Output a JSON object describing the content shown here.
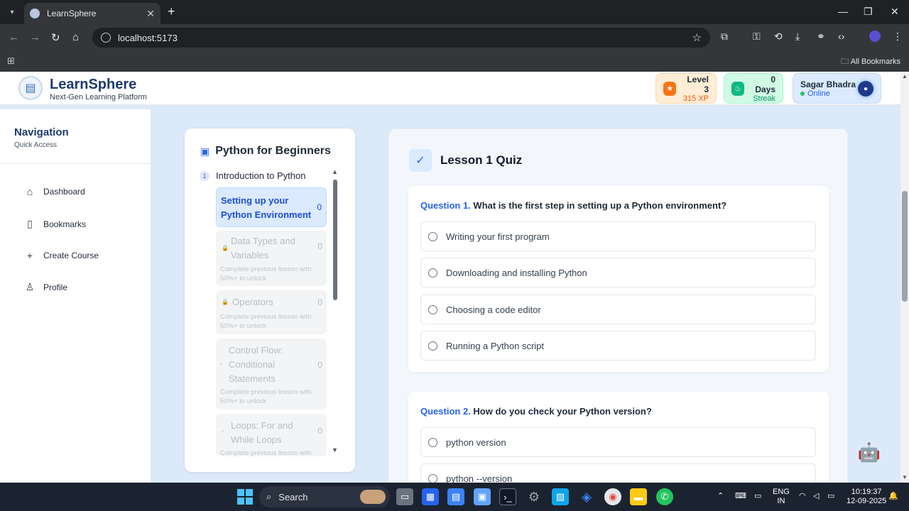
{
  "browser": {
    "tab_title": "LearnSphere",
    "url": "localhost:5173",
    "all_bookmarks": "All Bookmarks"
  },
  "header": {
    "brand": "LearnSphere",
    "tagline": "Next-Gen Learning Platform",
    "level_label": "Level 3",
    "xp": "315 XP",
    "streak_label": "0 Days",
    "streak_sub": "Streak",
    "user_name": "Sagar Bhadra",
    "user_status": "Online"
  },
  "sidebar": {
    "title": "Navigation",
    "subtitle": "Quick Access",
    "items": [
      {
        "label": "Dashboard",
        "icon": "home-icon"
      },
      {
        "label": "Bookmarks",
        "icon": "book-icon"
      },
      {
        "label": "Create Course",
        "icon": "plus-icon"
      },
      {
        "label": "Profile",
        "icon": "user-icon"
      }
    ]
  },
  "course": {
    "title": "Python for Beginners",
    "module_number": "1",
    "module_title": "Introduction to Python",
    "lessons": [
      {
        "line1": "Setting up your",
        "line2": "Python Environment",
        "count": "0"
      },
      {
        "line1": "Data Types and",
        "line2": "Variables",
        "count": "0",
        "note1": "Complete previous lesson with",
        "note2": "50%+ to unlock"
      },
      {
        "line1": "Operators",
        "count": "0",
        "note1": "Complete previous lesson with",
        "note2": "50%+ to unlock"
      },
      {
        "line1": "Control Flow:",
        "line2": "Conditional",
        "line3": "Statements",
        "count": "0",
        "note1": "Complete previous lesson with",
        "note2": "50%+ to unlock"
      },
      {
        "line1": "Loops: For and",
        "line2": "While Loops",
        "count": "0",
        "note1": "Complete previous lesson with"
      }
    ]
  },
  "quiz": {
    "title": "Lesson 1 Quiz",
    "questions": [
      {
        "number": "Question 1.",
        "text": "What is the first step in setting up a Python environment?",
        "options": [
          "Writing your first program",
          "Downloading and installing Python",
          "Choosing a code editor",
          "Running a Python script"
        ]
      },
      {
        "number": "Question 2.",
        "text": "How do you check your Python version?",
        "options": [
          "python version",
          "python --version"
        ]
      }
    ]
  },
  "taskbar": {
    "search": "Search",
    "lang1": "ENG",
    "lang2": "IN",
    "time": "10:19:37",
    "date": "12-09-2025"
  }
}
